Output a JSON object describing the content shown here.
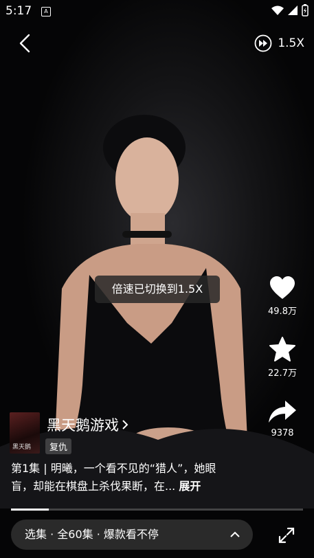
{
  "status_bar": {
    "time": "5:17",
    "notification_glyph": "A"
  },
  "top_bar": {
    "speed_label": "1.5X"
  },
  "toast": {
    "text": "倍速已切换到1.5X"
  },
  "actions": {
    "like": {
      "count": "49.8万"
    },
    "favorite": {
      "count": "22.7万"
    },
    "share": {
      "count": "9378"
    }
  },
  "drama": {
    "title": "黑天鹅游戏",
    "tag": "复仇",
    "description": "第1集 | 明曦，一个看不见的“猎人”，她眼盲，却能在棋盘上杀伐果断，在...",
    "expand_label": "展开",
    "poster_text": "黑天鹅"
  },
  "progress": {
    "played_fraction": 0.13
  },
  "episodes_bar": {
    "label": "选集 · 全60集 · 爆款看不停"
  },
  "icons": [
    "back-arrow-icon",
    "fast-forward-icon",
    "heart-icon",
    "star-icon",
    "share-icon",
    "chevron-right-icon",
    "chevron-up-icon",
    "fullscreen-icon"
  ]
}
